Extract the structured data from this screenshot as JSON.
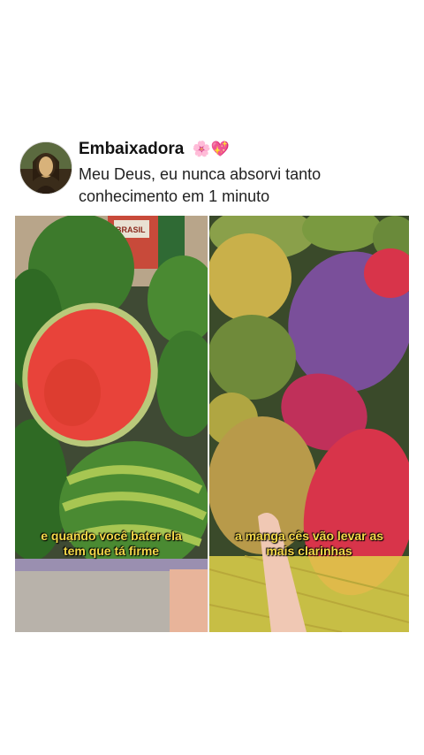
{
  "post": {
    "author_name": "Embaixadora",
    "author_emojis": "🌸💖",
    "caption_line1": "Meu Deus, eu nunca absorvi tanto",
    "caption_line2": "conhecimento em 1 minuto"
  },
  "video": {
    "left_panel": {
      "subtitle_line1": "e quando você bater ela",
      "subtitle_line2": "tem que tá firme",
      "crate_label": "BRASIL"
    },
    "right_panel": {
      "subtitle_line1": "a manga cês vão levar as",
      "subtitle_line2": "mais clarinhas"
    }
  },
  "colors": {
    "subtitle": "#f5d94a",
    "watermelon_flesh": "#e8433a",
    "mango_red": "#d8344a",
    "mango_purple": "#7a4f9a"
  }
}
